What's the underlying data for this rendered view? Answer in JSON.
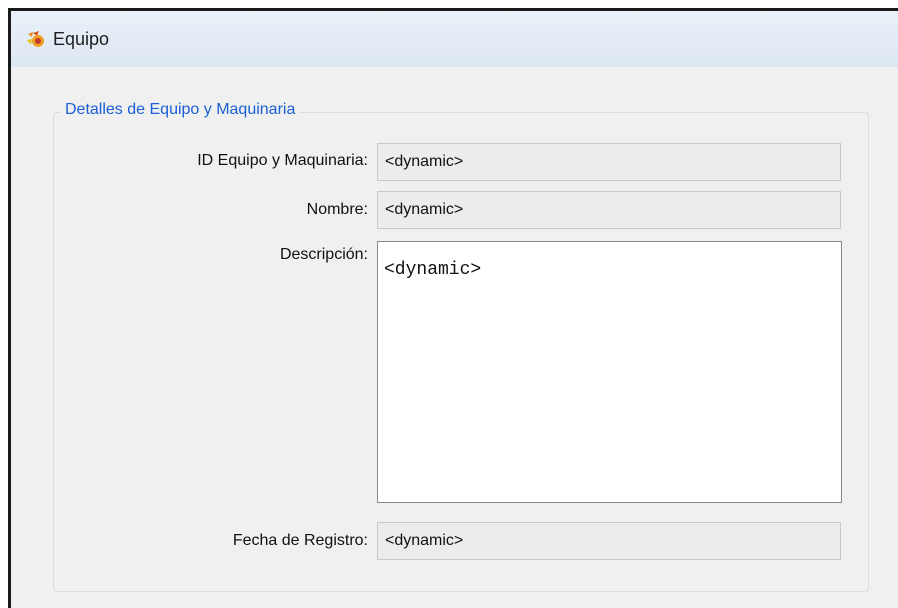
{
  "window": {
    "title": "Equipo",
    "app_icon": "app-logo-icon"
  },
  "group": {
    "legend": "Detalles de Equipo y Maquinaria"
  },
  "fields": {
    "id_label": "ID Equipo y Maquinaria:",
    "id_value": "<dynamic>",
    "nombre_label": "Nombre:",
    "nombre_value": "<dynamic>",
    "descripcion_label": "Descripción:",
    "descripcion_value": "<dynamic>",
    "fecha_label": "Fecha de Registro:",
    "fecha_value": "<dynamic>"
  },
  "colors": {
    "legend": "#1a5fd6",
    "readonly_field_bg": "#ececec",
    "titlebar": "#dde7f3"
  }
}
